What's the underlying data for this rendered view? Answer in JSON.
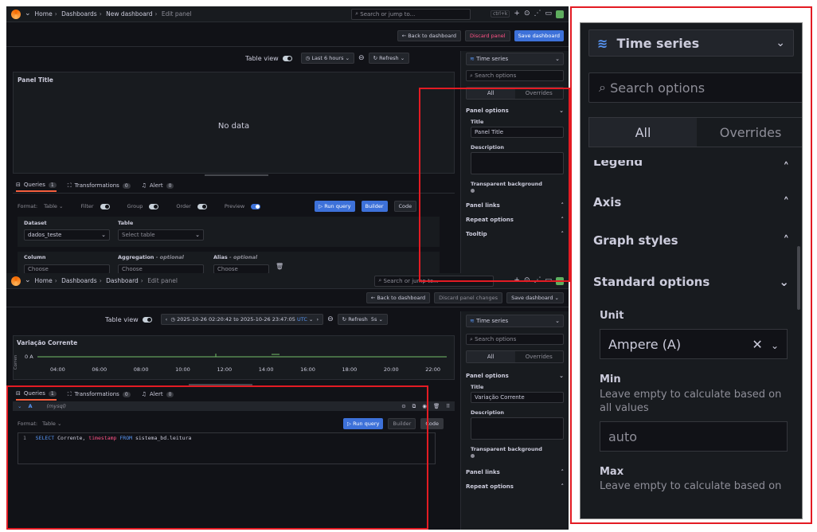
{
  "top_shot": {
    "breadcrumb": [
      "Home",
      "Dashboards",
      "New dashboard",
      "Edit panel"
    ],
    "search_placeholder": "Search or jump to...",
    "kbd": "ctrl+k",
    "back_label": "← Back to dashboard",
    "discard_label": "Discard panel",
    "save_label": "Save dashboard",
    "table_view": "Table view",
    "time_range": "Last 6 hours",
    "refresh": "Refresh",
    "panel_title": "Panel Title",
    "no_data": "No data",
    "tabs": [
      {
        "label": "Queries",
        "count": "1"
      },
      {
        "label": "Transformations",
        "count": "0"
      },
      {
        "label": "Alert",
        "count": "0"
      }
    ],
    "format_label": "Format:",
    "format_value": "Table",
    "filter": "Filter",
    "group": "Group",
    "order": "Order",
    "preview": "Preview",
    "run_query": "▷ Run query",
    "builder": "Builder",
    "code": "Code",
    "dataset_label": "Dataset",
    "dataset_value": "dados_teste",
    "table_label": "Table",
    "table_placeholder": "Select table",
    "column_label": "Column",
    "aggregation_label": "Aggregation",
    "aggregation_hint": "- optional",
    "alias_label": "Alias",
    "alias_hint": "- optional",
    "choose": "Choose",
    "viz": "Time series",
    "search_options": "Search options",
    "all": "All",
    "overrides": "Overrides",
    "panel_options": "Panel options",
    "title_label": "Title",
    "title_value": "Panel Title",
    "description_label": "Description",
    "transparent_label": "Transparent background",
    "panel_links": "Panel links",
    "repeat_options": "Repeat options",
    "tooltip": "Tooltip"
  },
  "bottom_shot": {
    "breadcrumb": [
      "Home",
      "Dashboards",
      "Dashboard",
      "Edit panel"
    ],
    "search_placeholder": "Search or jump to...",
    "back_label": "← Back to dashboard",
    "discard_label": "Discard panel changes",
    "save_label": "Save dashboard",
    "table_view": "Table view",
    "time_range": "2025-10-26 02:20:42 to 2025-10-26 23:47:05",
    "tz": "UTC",
    "refresh": "Refresh",
    "refresh_interval": "5s",
    "panel_title": "Variação Corrente",
    "y_axis_label": "Corren",
    "y_tick": "0 A",
    "x_ticks": [
      "04:00",
      "06:00",
      "08:00",
      "10:00",
      "12:00",
      "14:00",
      "16:00",
      "18:00",
      "20:00",
      "22:00"
    ],
    "tabs": [
      {
        "label": "Queries",
        "count": "1"
      },
      {
        "label": "Transformations",
        "count": "0"
      },
      {
        "label": "Alert",
        "count": "0"
      }
    ],
    "query_ref": "A",
    "query_ds": "(mysql)",
    "format_label": "Format:",
    "format_value": "Table",
    "run_query": "▷ Run query",
    "builder": "Builder",
    "code": "Code",
    "line_no": "1",
    "sql": {
      "k1": "SELECT",
      "c1": "Corrente,",
      "c2": "timestamp",
      "k2": "FROM",
      "c3": "sistema_bd.leitura"
    },
    "viz": "Time series",
    "search_options": "Search options",
    "all": "All",
    "overrides": "Overrides",
    "panel_options": "Panel options",
    "title_label": "Title",
    "title_value": "Variação Corrente",
    "description_label": "Description",
    "transparent_label": "Transparent background",
    "panel_links": "Panel links",
    "repeat_options": "Repeat options"
  },
  "zoom": {
    "viz": "Time series",
    "search_options": "Search options",
    "all": "All",
    "overrides": "Overrides",
    "legend": "Legend",
    "axis": "Axis",
    "graph_styles": "Graph styles",
    "standard_options": "Standard options",
    "unit_label": "Unit",
    "unit_value": "Ampere (A)",
    "min_label": "Min",
    "min_hint": "Leave empty to calculate based on all values",
    "min_placeholder": "auto",
    "max_label": "Max",
    "max_hint": "Leave empty to calculate based on"
  },
  "colors": {
    "accent": "#3d71d9",
    "highlight": "#e31b23",
    "series": "#73bf69"
  }
}
